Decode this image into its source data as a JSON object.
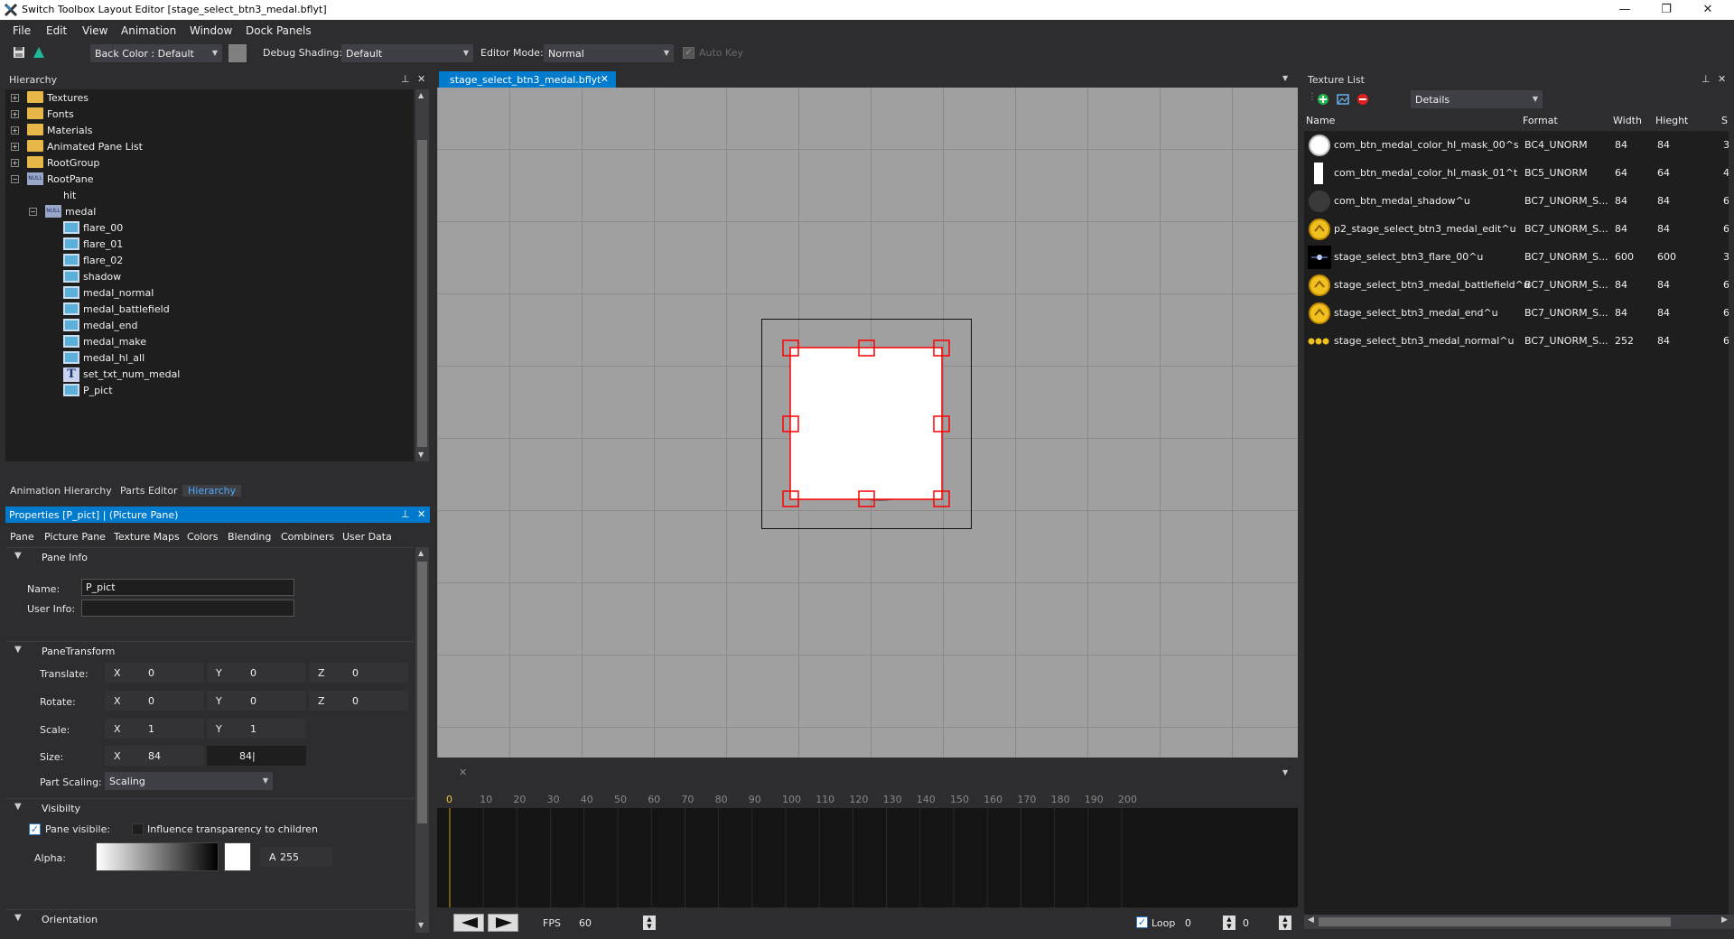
{
  "window": {
    "title": "Switch Toolbox Layout Editor [stage_select_btn3_medal.bflyt]",
    "minimize": "—",
    "maximize": "❐",
    "close": "✕"
  },
  "menu": [
    "File",
    "Edit",
    "View",
    "Animation",
    "Window",
    "Dock Panels"
  ],
  "toolbar": {
    "back_color_label": "Back Color : Default",
    "debug_shading_label": "Debug Shading:",
    "debug_shading_value": "Default",
    "editor_mode_label": "Editor Mode:",
    "editor_mode_value": "Normal",
    "auto_key_label": "Auto Key"
  },
  "hierarchy": {
    "title": "Hierarchy",
    "items": [
      {
        "label": "Textures",
        "type": "folder",
        "exp": "+"
      },
      {
        "label": "Fonts",
        "type": "folder",
        "exp": "+"
      },
      {
        "label": "Materials",
        "type": "folder",
        "exp": "+"
      },
      {
        "label": "Animated Pane List",
        "type": "folder",
        "exp": "+"
      },
      {
        "label": "RootGroup",
        "type": "folder",
        "exp": "+"
      },
      {
        "label": "RootPane",
        "type": "null",
        "exp": "−"
      },
      {
        "label": "hit",
        "type": "none"
      },
      {
        "label": "medal",
        "type": "null",
        "exp": "−"
      },
      {
        "label": "flare_00",
        "type": "pic"
      },
      {
        "label": "flare_01",
        "type": "pic"
      },
      {
        "label": "flare_02",
        "type": "pic"
      },
      {
        "label": "shadow",
        "type": "pic"
      },
      {
        "label": "medal_normal",
        "type": "pic"
      },
      {
        "label": "medal_battlefield",
        "type": "pic"
      },
      {
        "label": "medal_end",
        "type": "pic"
      },
      {
        "label": "medal_make",
        "type": "pic"
      },
      {
        "label": "medal_hl_all",
        "type": "pic"
      },
      {
        "label": "set_txt_num_medal",
        "type": "text"
      },
      {
        "label": "P_pict",
        "type": "pic"
      }
    ],
    "null_icon_text": "NULL",
    "text_icon_text": "T",
    "tabs": [
      "Animation Hierarchy",
      "Parts Editor",
      "Hierarchy"
    ]
  },
  "properties": {
    "title": "Properties [P_pict]     |  (Picture Pane)",
    "tabs": [
      "Pane",
      "Picture Pane",
      "Texture Maps",
      "Colors",
      "Blending",
      "Combiners",
      "User Data"
    ],
    "pane_info": {
      "header": "Pane Info",
      "name_label": "Name:",
      "name_value": "P_pict",
      "user_info_label": "User Info:",
      "user_info_value": ""
    },
    "transform": {
      "header": "PaneTransform",
      "translate_label": "Translate:",
      "translate": {
        "x": "0",
        "y": "0",
        "z": "0"
      },
      "rotate_label": "Rotate:",
      "rotate": {
        "x": "0",
        "y": "0",
        "z": "0"
      },
      "scale_label": "Scale:",
      "scale": {
        "x": "1",
        "y": "1"
      },
      "size_label": "Size:",
      "size": {
        "x": "84",
        "y": "84|"
      },
      "part_scaling_label": "Part Scaling:",
      "part_scaling_value": "Scaling",
      "axes": {
        "x": "X",
        "y": "Y",
        "z": "Z"
      }
    },
    "visibility": {
      "header": "Visibilty",
      "pane_visible_label": "Pane visibile:",
      "influence_label": "Influence transparency to children",
      "alpha_label": "Alpha:",
      "alpha_prefix": "A",
      "alpha_value": "255"
    },
    "orientation_header": "Orientation"
  },
  "editor": {
    "doc_tab": "stage_select_btn3_medal.bflyt"
  },
  "timeline": {
    "ticks": [
      "0",
      "10",
      "20",
      "30",
      "40",
      "50",
      "60",
      "70",
      "80",
      "90",
      "100",
      "110",
      "120",
      "130",
      "140",
      "150",
      "160",
      "170",
      "180",
      "190",
      "200"
    ],
    "fps_label": "FPS",
    "fps_value": "60",
    "loop_label": "Loop",
    "loop_value": "0",
    "frame_value": "0"
  },
  "texture_list": {
    "title": "Texture List",
    "view_mode": "Details",
    "columns": [
      "Name",
      "Format",
      "Width",
      "Hieght",
      "S"
    ],
    "rows": [
      {
        "name": "com_btn_medal_color_hl_mask_00^s",
        "format": "BC4_UNORM",
        "width": "84",
        "height": "84",
        "s": "3",
        "thumb": "white-circle"
      },
      {
        "name": "com_btn_medal_color_hl_mask_01^t",
        "format": "BC5_UNORM",
        "width": "64",
        "height": "64",
        "s": "4",
        "thumb": "white-bar"
      },
      {
        "name": "com_btn_medal_shadow^u",
        "format": "BC7_UNORM_S...",
        "width": "84",
        "height": "84",
        "s": "6",
        "thumb": "dark-circle"
      },
      {
        "name": "p2_stage_select_btn3_medal_edit^u",
        "format": "BC7_UNORM_S...",
        "width": "84",
        "height": "84",
        "s": "6",
        "thumb": "gold-medal"
      },
      {
        "name": "stage_select_btn3_flare_00^u",
        "format": "BC7_UNORM_S...",
        "width": "600",
        "height": "600",
        "s": "3",
        "thumb": "flare"
      },
      {
        "name": "stage_select_btn3_medal_battlefield^u",
        "format": "BC7_UNORM_S...",
        "width": "84",
        "height": "84",
        "s": "6",
        "thumb": "gold-medal"
      },
      {
        "name": "stage_select_btn3_medal_end^u",
        "format": "BC7_UNORM_S...",
        "width": "84",
        "height": "84",
        "s": "6",
        "thumb": "gold-medal"
      },
      {
        "name": "stage_select_btn3_medal_normal^u",
        "format": "BC7_UNORM_S...",
        "width": "252",
        "height": "84",
        "s": "6",
        "thumb": "gold-strip"
      }
    ]
  },
  "colors": {
    "accent": "#007acc",
    "selection": "#ff0000",
    "folder": "#e8b74a",
    "viewport_bg": "#a0a0a0"
  }
}
